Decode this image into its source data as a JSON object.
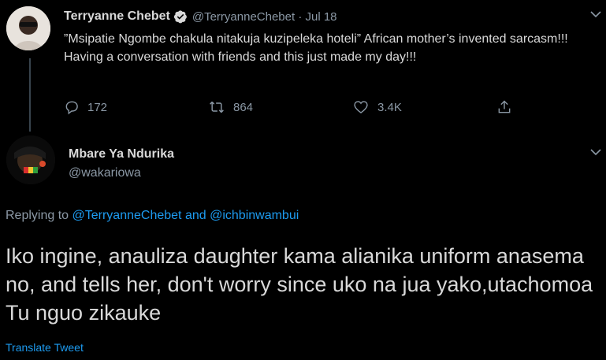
{
  "original_tweet": {
    "author_name": "Terryanne Chebet",
    "handle_and_time": "@TerryanneChebet · Jul 18",
    "text": "”Msipatie Ngombe chakula nitakuja kuzipeleka hoteli” African mother’s invented sarcasm!!!  Having a conversation with friends and this just made my day!!!",
    "reply_count": "172",
    "retweet_count": "864",
    "like_count": "3.4K"
  },
  "reply_tweet": {
    "author_name": "Mbare Ya Ndurika",
    "handle": "@wakariowa",
    "replying_to_prefix": "Replying to",
    "replying_to_user_1": "@TerryanneChebet",
    "replying_to_and": "and",
    "replying_to_user_2": "@ichbinwambui",
    "text": "Iko ingine, anauliza daughter kama alianika uniform anasema no, and tells her, don't worry since uko na jua yako,utachomoa Tu nguo zikauke",
    "translate_label": "Translate Tweet"
  },
  "colors": {
    "background": "#000000",
    "text": "#d9d9d9",
    "muted": "#8b98a5",
    "link": "#1d9bf0",
    "verified": "#d9d9d9"
  },
  "icons": [
    "verified-badge-icon",
    "chevron-down-icon",
    "reply-icon",
    "retweet-icon",
    "like-icon",
    "share-icon"
  ]
}
